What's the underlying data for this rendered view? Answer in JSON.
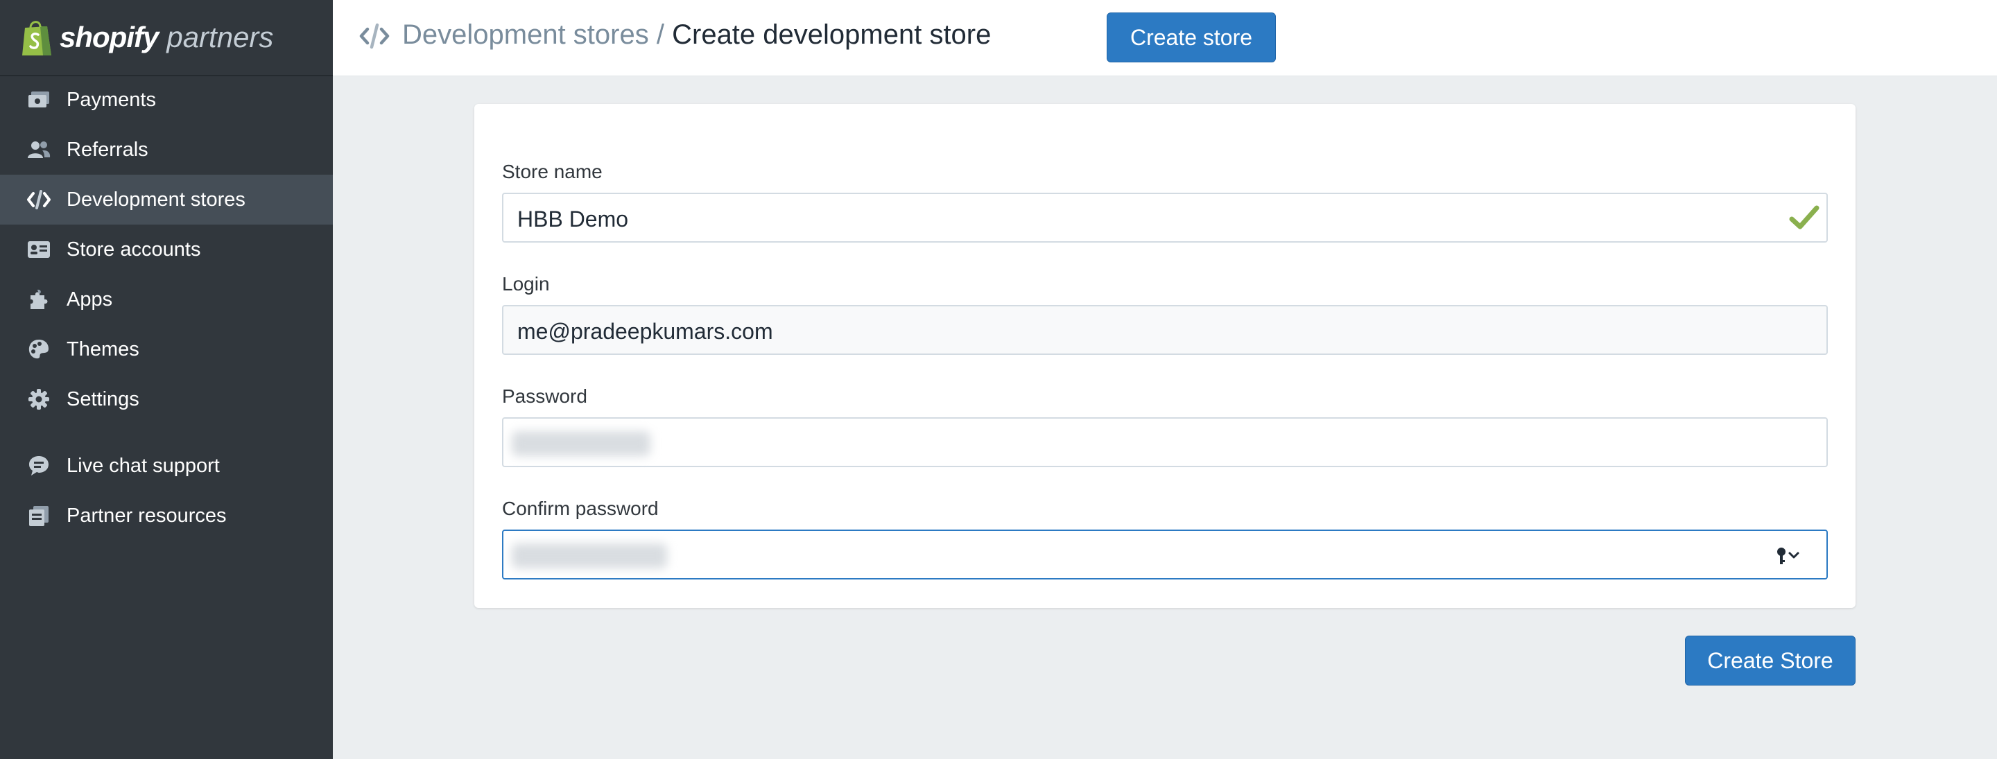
{
  "brand": {
    "name": "shopify",
    "product": "partners"
  },
  "sidebar": {
    "items": [
      {
        "label": "Payments",
        "icon": "payments-icon"
      },
      {
        "label": "Referrals",
        "icon": "referrals-icon"
      },
      {
        "label": "Development stores",
        "icon": "code-icon",
        "active": true
      },
      {
        "label": "Store accounts",
        "icon": "id-card-icon"
      },
      {
        "label": "Apps",
        "icon": "puzzle-icon"
      },
      {
        "label": "Themes",
        "icon": "palette-icon"
      },
      {
        "label": "Settings",
        "icon": "gear-icon"
      },
      {
        "label": "Live chat support",
        "icon": "chat-icon"
      },
      {
        "label": "Partner resources",
        "icon": "resources-icon"
      }
    ]
  },
  "header": {
    "breadcrumb_link": "Development stores",
    "separator": "/",
    "title": "Create development store",
    "action_label": "Create store"
  },
  "form": {
    "store_name_label": "Store name",
    "store_name_value": "HBB Demo",
    "login_label": "Login",
    "login_value": "me@pradeepkumars.com",
    "password_label": "Password",
    "confirm_password_label": "Confirm password",
    "submit_label": "Create Store"
  },
  "colors": {
    "sidebar_bg": "#31373d",
    "accent": "#2c7ac3",
    "valid_check": "#8ab04e"
  }
}
